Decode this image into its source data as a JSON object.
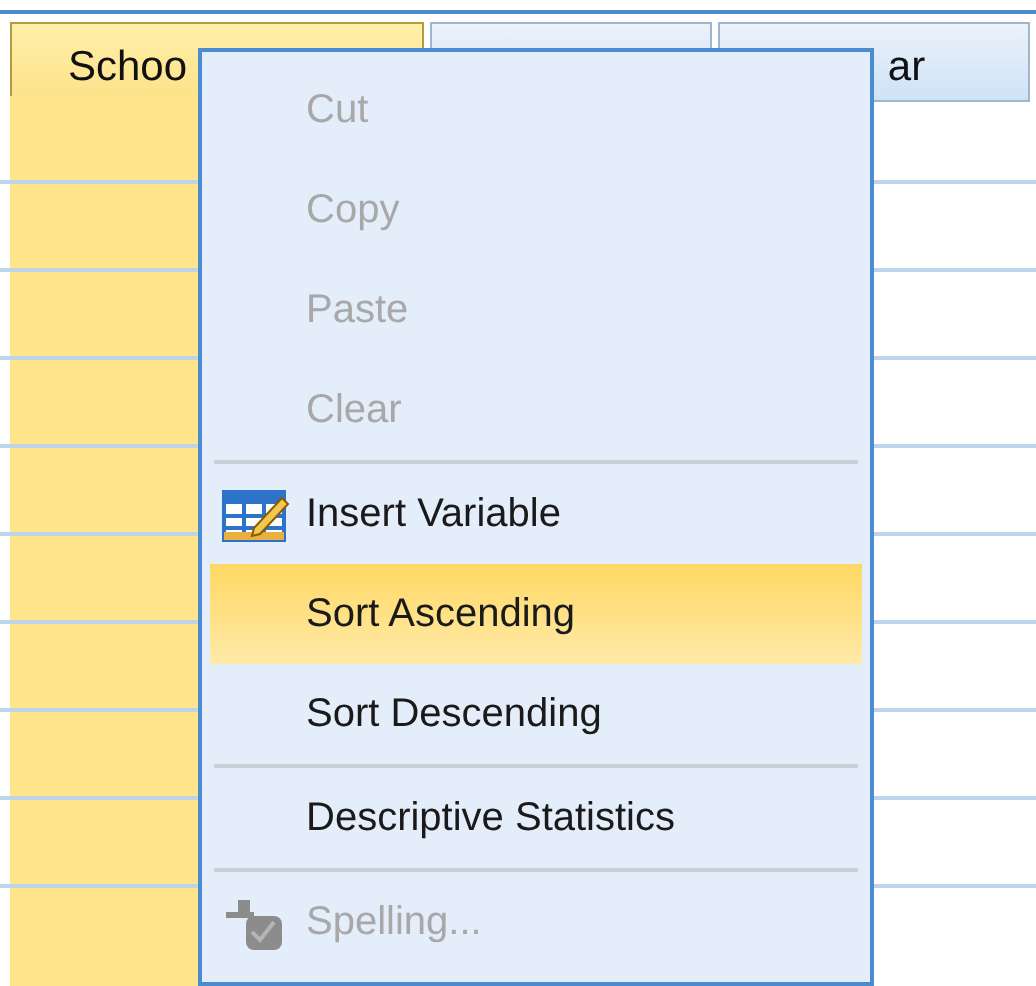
{
  "grid": {
    "columns": [
      {
        "title": "Schoo",
        "selected": true
      },
      {
        "selected": false
      },
      {
        "title": "ar",
        "selected": false
      }
    ]
  },
  "context_menu": {
    "items": [
      {
        "kind": "item",
        "label": "Cut",
        "disabled": true,
        "selected": false
      },
      {
        "kind": "item",
        "label": "Copy",
        "disabled": true,
        "selected": false
      },
      {
        "kind": "item",
        "label": "Paste",
        "disabled": true,
        "selected": false
      },
      {
        "kind": "item",
        "label": "Clear",
        "disabled": true,
        "selected": false
      },
      {
        "kind": "separator"
      },
      {
        "kind": "iconitem",
        "label": "Insert Variable",
        "disabled": false,
        "selected": false
      },
      {
        "kind": "item",
        "label": "Sort Ascending",
        "disabled": false,
        "selected": true
      },
      {
        "kind": "item",
        "label": "Sort Descending",
        "disabled": false,
        "selected": false
      },
      {
        "kind": "separator"
      },
      {
        "kind": "item",
        "label": "Descriptive Statistics",
        "disabled": false,
        "selected": false
      },
      {
        "kind": "separator"
      },
      {
        "kind": "iconitem",
        "label": "Spelling...",
        "disabled": true,
        "selected": false
      }
    ]
  }
}
